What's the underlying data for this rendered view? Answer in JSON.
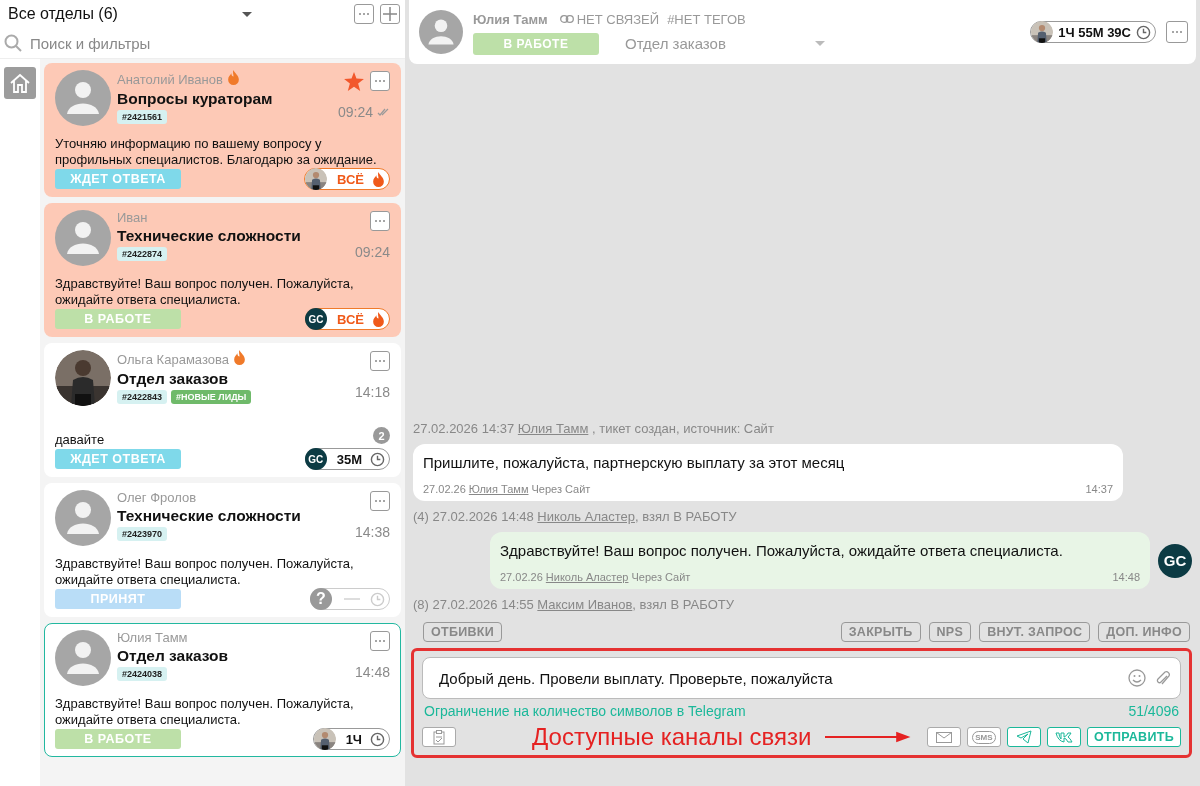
{
  "left_panel": {
    "department": "Все отделы (6)",
    "search": {
      "placeholder": "Поиск и фильтры"
    }
  },
  "tickets": [
    {
      "name": "Анатолий Иванов",
      "hot": true,
      "title": "Вопросы кураторам",
      "tags": [
        {
          "text": "#2421561",
          "color": "#d6f1f1"
        }
      ],
      "time": "09:24",
      "read": true,
      "starred": true,
      "urgent": true,
      "selected": false,
      "photo": false,
      "message": "Уточняю информацию по вашему вопросу у профильных специалистов. Благодарю за ожидание.",
      "status": {
        "text": "ЖДЕТ ОТВЕТА",
        "color": "#7fd9ea"
      },
      "timer": {
        "text": "ВСЁ",
        "kind": "fire"
      }
    },
    {
      "name": "Иван",
      "hot": false,
      "title": "Технические сложности",
      "tags": [
        {
          "text": "#2422874",
          "color": "#d6f1f1"
        }
      ],
      "time": "09:24",
      "read": false,
      "starred": false,
      "urgent": true,
      "selected": false,
      "photo": false,
      "message": "Здравствуйте! Ваш вопрос получен. Пожалуйста, ожидайте ответа специалиста.",
      "status": {
        "text": "В РАБОТЕ",
        "color": "#bde0a8"
      },
      "timer": {
        "agent": {
          "kind": "logo",
          "text": "GC"
        },
        "text": "ВСЁ",
        "kind": "fire"
      }
    },
    {
      "name": "Ольга Карамазова",
      "hot": true,
      "title": "Отдел заказов",
      "tags": [
        {
          "text": "#2422843",
          "color": "#d6f1f1"
        },
        {
          "text": "#НОВЫЕ ЛИДЫ",
          "color": "#6fba6a"
        }
      ],
      "time": "14:18",
      "read": false,
      "starred": false,
      "urgent": false,
      "selected": false,
      "photo": true,
      "message": "давайте",
      "unread": "2",
      "status": {
        "text": "ЖДЕТ ОТВЕТА",
        "color": "#7fd9ea"
      },
      "timer": {
        "agent": {
          "kind": "logo",
          "text": "GC"
        },
        "text": "35М",
        "kind": "clock"
      }
    },
    {
      "name": "Олег Фролов",
      "hot": false,
      "title": "Технические сложности",
      "tags": [
        {
          "text": "#2423970",
          "color": "#d6f1f1"
        }
      ],
      "time": "14:38",
      "read": false,
      "starred": false,
      "urgent": false,
      "selected": false,
      "photo": false,
      "message": "Здравствуйте! Ваш вопрос получен. Пожалуйста, ожидайте ответа специалиста.",
      "status": {
        "text": "ПРИНЯТ",
        "color": "#b9ddf7"
      },
      "timer": {
        "agent": {
          "kind": "unknown",
          "text": "?"
        },
        "kind": "empty"
      }
    },
    {
      "name": "Юлия Тамм",
      "hot": false,
      "title": "Отдел заказов",
      "tags": [
        {
          "text": "#2424038",
          "color": "#d6f1f1"
        }
      ],
      "time": "14:48",
      "read": false,
      "starred": false,
      "urgent": false,
      "selected": true,
      "photo": false,
      "message": "Здравствуйте! Ваш вопрос получен. Пожалуйста, ожидайте ответа специалиста.",
      "status": {
        "text": "В РАБОТЕ",
        "color": "#bde0a8"
      },
      "timer": {
        "text": "1Ч",
        "kind": "clock"
      }
    }
  ],
  "chat_header": {
    "name": "Юлия Тамм",
    "links": "НЕТ СВЯЗЕЙ",
    "tags": "#НЕТ ТЕГОВ",
    "status": {
      "text": "В РАБОТЕ",
      "color": "#bde0a8"
    },
    "department": "Отдел заказов",
    "timer": "1Ч 55М 39С"
  },
  "chat": [
    {
      "kind": "event",
      "before": "27.02.2026 14:37 ",
      "link": "Юлия Тамм",
      "after": " , тикет создан, источник: Сайт"
    },
    {
      "kind": "incoming",
      "text": "Пришлите, пожалуйста, партнерскую выплату за этот месяц",
      "date": "27.02.26",
      "author": "Юлия Тамм",
      "via": "Через Сайт",
      "time": "14:37"
    },
    {
      "kind": "event",
      "before": "(4) 27.02.2026 14:48 ",
      "link": "Николь Аластер",
      "after": ", взял В РАБОТУ"
    },
    {
      "kind": "outgoing",
      "text": "Здравствуйте! Ваш вопрос получен. Пожалуйста, ожидайте ответа специалиста.",
      "date": "27.02.26",
      "author": "Николь Аластер",
      "via": "Через Сайт",
      "time": "14:48",
      "avatar_text": "GC"
    },
    {
      "kind": "event",
      "before": "(8) 27.02.2026 14:55 ",
      "link": "Максим Иванов",
      "after": ", взял В РАБОТУ"
    }
  ],
  "actions_left": [
    "ОТБИВКИ"
  ],
  "actions_right": [
    "ЗАКРЫТЬ",
    "NPS",
    "ВНУТ. ЗАПРОС",
    "ДОП. ИНФО"
  ],
  "composer": {
    "value": "Добрый день. Провели выплату. Проверьте, пожалуйста",
    "limit_note": "Ограничение на количество символов в Telegram",
    "counter": "51/4096",
    "annotation": "Доступные каналы связи",
    "channels": [
      {
        "kind": "email",
        "enabled": false
      },
      {
        "kind": "sms",
        "label": "SMS",
        "enabled": false
      },
      {
        "kind": "telegram",
        "enabled": true
      },
      {
        "kind": "vk",
        "enabled": true
      }
    ],
    "send": "ОТПРАВИТЬ"
  }
}
